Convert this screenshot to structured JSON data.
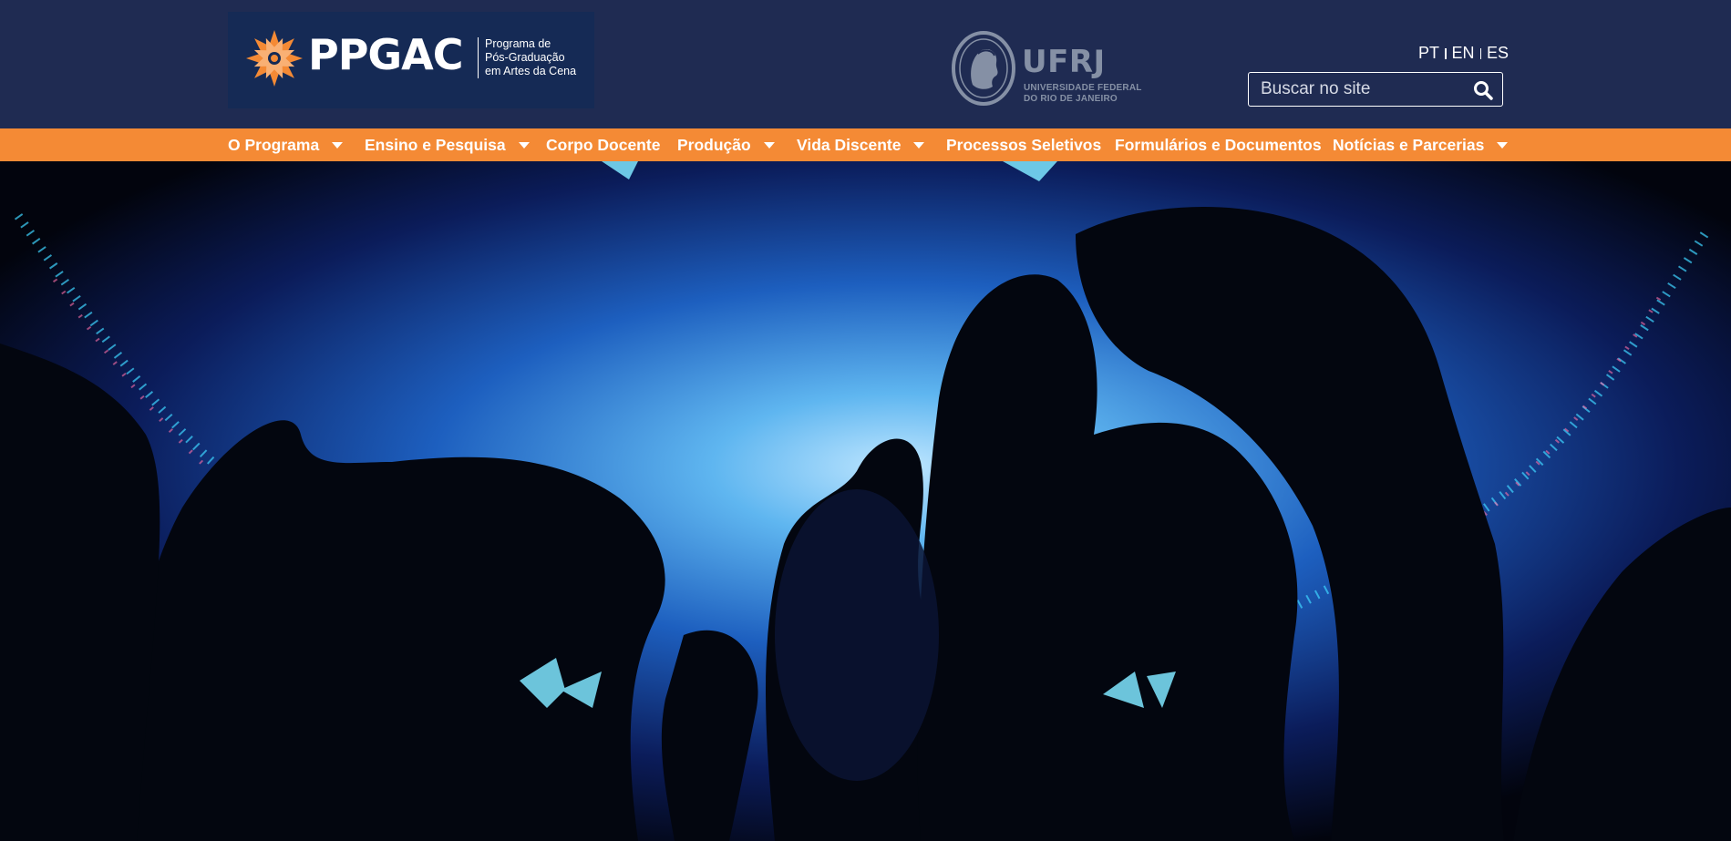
{
  "header": {
    "logo": {
      "name": "PPGAC",
      "subtitle_lines": [
        "Programa de",
        "Pós-Graduação",
        "em Artes da Cena"
      ]
    },
    "university_logo": {
      "name": "UFRJ",
      "subtitle_lines": [
        "UNIVERSIDADE FEDERAL",
        "DO RIO DE JANEIRO"
      ]
    },
    "languages": [
      "PT",
      "EN",
      "ES"
    ],
    "search": {
      "placeholder": "Buscar no site",
      "icon": "search-icon"
    }
  },
  "nav": {
    "items": [
      {
        "label": "O Programa",
        "has_dropdown": true
      },
      {
        "label": "Ensino e Pesquisa",
        "has_dropdown": true
      },
      {
        "label": "Corpo Docente",
        "has_dropdown": false
      },
      {
        "label": "Produção",
        "has_dropdown": true
      },
      {
        "label": "Vida Discente",
        "has_dropdown": true
      },
      {
        "label": "Processos Seletivos",
        "has_dropdown": false
      },
      {
        "label": "Formulários e Documentos",
        "has_dropdown": false
      },
      {
        "label": "Notícias e Parcerias",
        "has_dropdown": true
      }
    ]
  },
  "colors": {
    "header_bg": "#1f2b52",
    "logo_bg": "#152a55",
    "nav_bg": "#f48a35",
    "logo_star": "#f48a35",
    "ufrj_gray": "#8590a5"
  }
}
